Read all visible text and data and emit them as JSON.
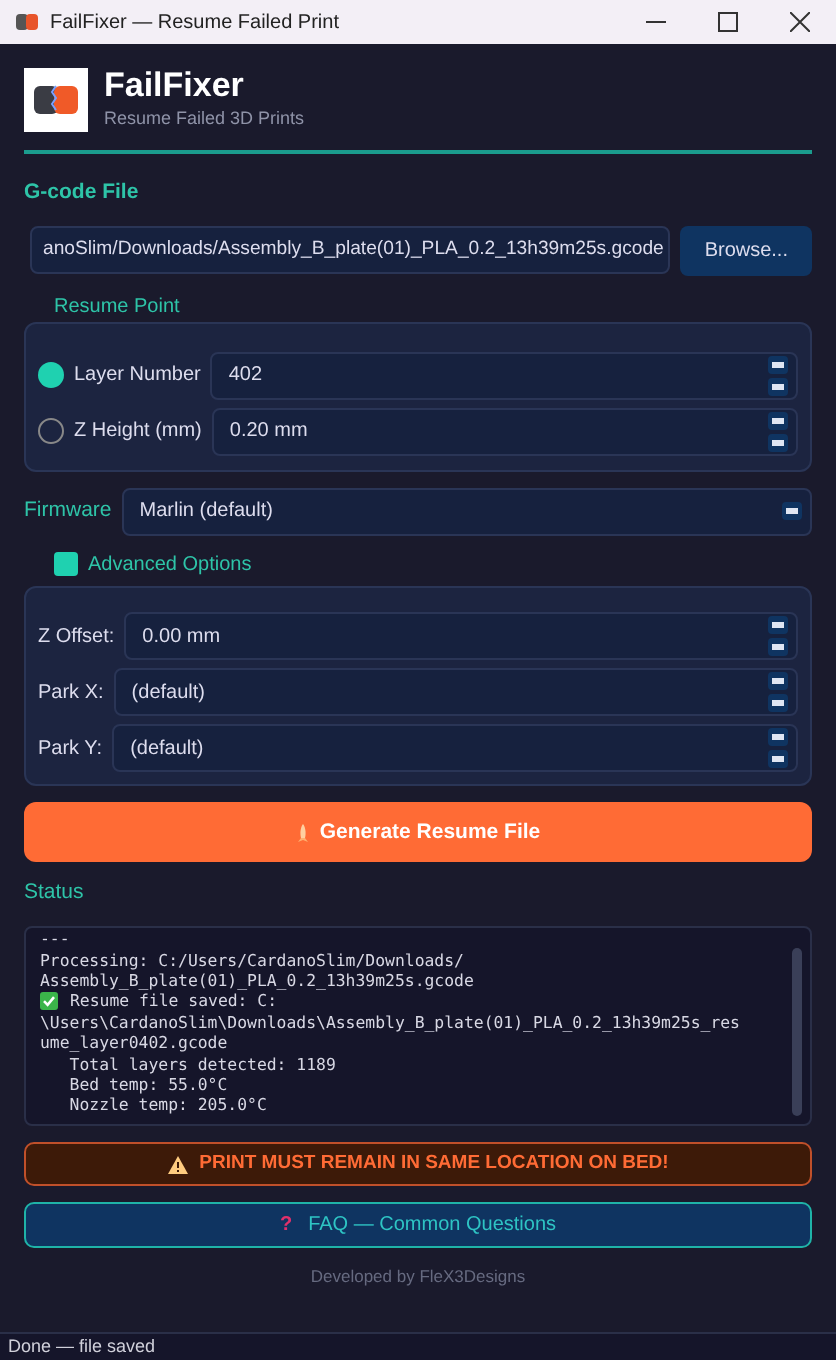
{
  "window": {
    "title": "FailFixer — Resume Failed Print"
  },
  "header": {
    "title": "FailFixer",
    "subtitle": "Resume Failed 3D Prints"
  },
  "gcode": {
    "label": "G-code File",
    "value": "anoSlim/Downloads/Assembly_B_plate(01)_PLA_0.2_13h39m25s.gcode",
    "button": "Browse..."
  },
  "resume_point": {
    "title": "Resume Point",
    "options": [
      {
        "label": "Layer Number",
        "value": "402",
        "selected": true
      },
      {
        "label": "Z Height (mm)",
        "value": "0.20 mm",
        "selected": false
      }
    ]
  },
  "firmware": {
    "label": "Firmware",
    "value": "Marlin (default)"
  },
  "advanced": {
    "title": "Advanced Options",
    "checked": true,
    "fields": [
      {
        "label": "Z Offset:",
        "value": "0.00 mm"
      },
      {
        "label": "Park X:",
        "value": "(default)"
      },
      {
        "label": "Park Y:",
        "value": "(default)"
      }
    ]
  },
  "generate_button": "Generate Resume File",
  "status": {
    "label": "Status",
    "lines": [
      {
        "kind": "plain",
        "text": "---"
      },
      {
        "kind": "plain",
        "text": "Processing: C:/Users/CardanoSlim/Downloads/"
      },
      {
        "kind": "plain",
        "text": "Assembly_B_plate(01)_PLA_0.2_13h39m25s.gcode"
      },
      {
        "kind": "success",
        "text": "Resume file saved: C:"
      },
      {
        "kind": "plain",
        "text": "\\Users\\CardanoSlim\\Downloads\\Assembly_B_plate(01)_PLA_0.2_13h39m25s_res"
      },
      {
        "kind": "plain",
        "text": "ume_layer0402.gcode"
      },
      {
        "kind": "plain",
        "text": "   Total layers detected: 1189"
      },
      {
        "kind": "plain",
        "text": "   Bed temp: 55.0°C"
      },
      {
        "kind": "plain",
        "text": "   Nozzle temp: 205.0°C"
      }
    ]
  },
  "warning": "PRINT MUST REMAIN IN SAME LOCATION ON BED!",
  "faq": {
    "icon": "?",
    "label": "FAQ — Common Questions"
  },
  "footer": "Developed by FleX3Designs",
  "status_bar": "Done — file saved"
}
